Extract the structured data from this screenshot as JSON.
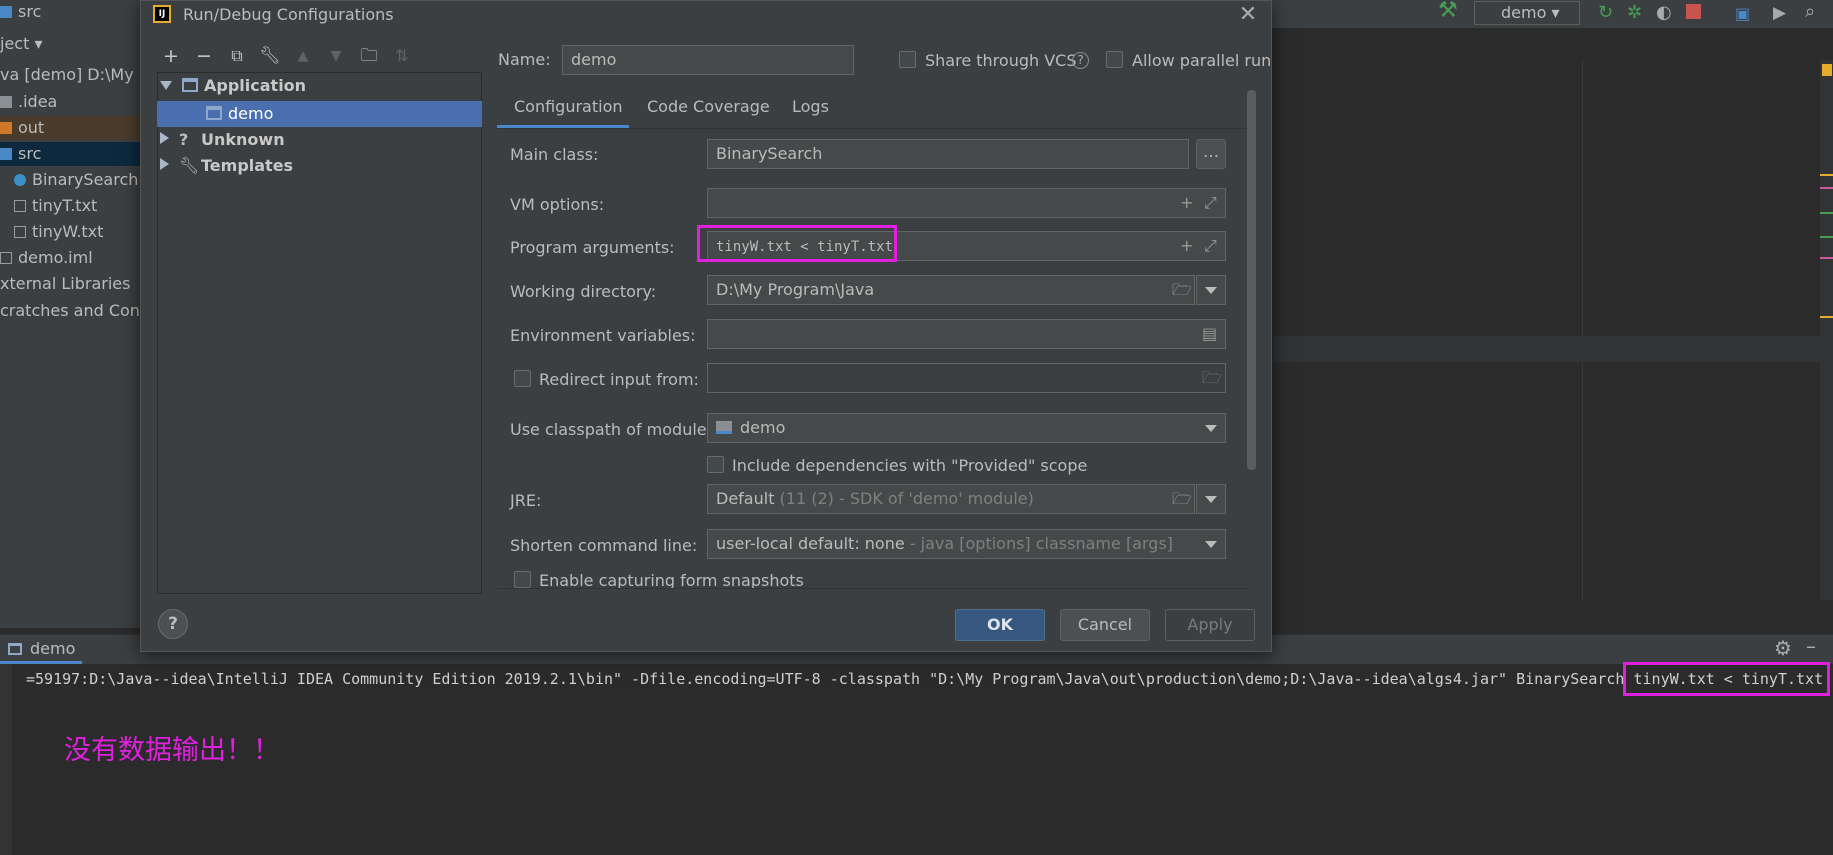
{
  "project_tree": {
    "rows": [
      {
        "label": "src",
        "color": "#bbbbbb"
      },
      {
        "label": "ject ▾",
        "color": "#bbbbbb"
      },
      {
        "label": "va [demo]  D:\\My P",
        "color": "#bbbbbb"
      },
      {
        "label": ".idea",
        "color": "#bbbbbb"
      },
      {
        "label": "out",
        "color": "#bbbbbb"
      },
      {
        "label": "src",
        "color": "#bbbbbb"
      },
      {
        "label": "BinarySearch",
        "color": "#bbbbbb"
      },
      {
        "label": "tinyT.txt",
        "color": "#bbbbbb"
      },
      {
        "label": "tinyW.txt",
        "color": "#bbbbbb"
      },
      {
        "label": "demo.iml",
        "color": "#bbbbbb"
      },
      {
        "label": "xternal Libraries",
        "color": "#bbbbbb"
      },
      {
        "label": "cratches and Conso",
        "color": "#bbbbbb"
      }
    ]
  },
  "top_toolbar": {
    "run_config": "demo"
  },
  "dialog": {
    "title": "Run/Debug Configurations",
    "app_logo": "IJ",
    "toolbar_icons": [
      "add-icon",
      "remove-icon",
      "copy-icon",
      "wrench-icon",
      "arrow-up-icon",
      "arrow-down-icon",
      "folder-add-icon",
      "sort-icon"
    ],
    "tree": {
      "application": "Application",
      "demo": "demo",
      "unknown": "Unknown",
      "templates": "Templates"
    },
    "name_label": "Name:",
    "name_value": "demo",
    "share_vcs": "Share through VCS",
    "allow_parallel": "Allow parallel run",
    "tabs": [
      "Configuration",
      "Code Coverage",
      "Logs"
    ],
    "form": {
      "main_class_label": "Main class:",
      "main_class_value": "BinarySearch",
      "vm_options_label": "VM options:",
      "vm_options_value": "",
      "program_args_label": "Program arguments:",
      "program_args_value": "tinyW.txt < tinyT.txt",
      "working_dir_label": "Working directory:",
      "working_dir_value": "D:\\My Program\\Java",
      "env_vars_label": "Environment variables:",
      "env_vars_value": "",
      "redirect_label": "Redirect input from:",
      "redirect_value": "",
      "classpath_label": "Use classpath of module:",
      "classpath_value": "demo",
      "include_deps_label": "Include dependencies with \"Provided\" scope",
      "jre_label": "JRE:",
      "jre_value": "Default",
      "jre_hint": " (11 (2) - SDK of 'demo' module)",
      "shorten_label": "Shorten command line:",
      "shorten_value": "user-local default: none",
      "shorten_hint": " - java [options] classname [args]",
      "capture_label": "Enable capturing form snapshots"
    },
    "buttons": {
      "help": "?",
      "ok": "OK",
      "cancel": "Cancel",
      "apply": "Apply"
    }
  },
  "run_panel": {
    "tab_label": "demo",
    "console_line": "=59197:D:\\Java--idea\\IntelliJ IDEA Community Edition 2019.2.1\\bin\" -Dfile.encoding=UTF-8 -classpath \"D:\\My Program\\Java\\out\\production\\demo;D:\\Java--idea\\algs4.jar\" BinarySearch tinyW.txt < tinyT.txt",
    "annotation": "没有数据输出！！"
  },
  "colors": {
    "highlight": "#e020e0",
    "selection": "#4b6eaf",
    "accent": "#4a88c7"
  }
}
